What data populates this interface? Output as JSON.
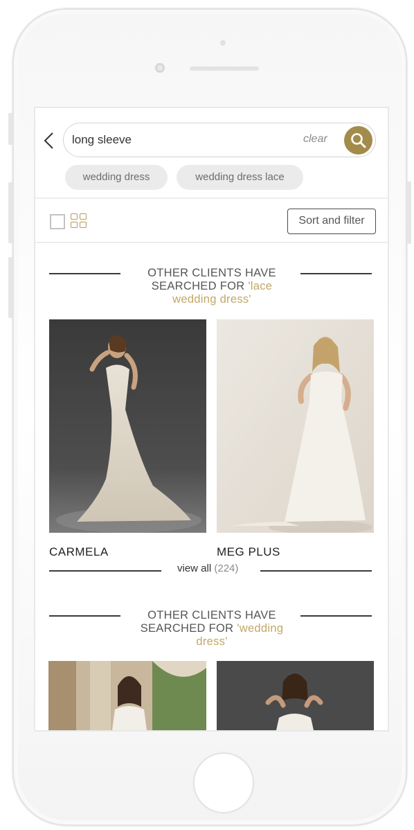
{
  "search": {
    "value": "long sleeve",
    "clear_label": "clear"
  },
  "suggestions": [
    "wedding dress",
    "wedding dress lace"
  ],
  "toolbar": {
    "sort_filter_label": "Sort and filter"
  },
  "sections": [
    {
      "heading_line1": "OTHER CLIENTS HAVE",
      "heading_prefix": "SEARCHED FOR ",
      "query_part1": "'lace",
      "query_part2": "wedding dress'",
      "products": [
        {
          "name": "CARMELA"
        },
        {
          "name": "MEG PLUS"
        }
      ],
      "view_all_label": "view all",
      "view_all_count": "(224)"
    },
    {
      "heading_line1": "OTHER CLIENTS HAVE",
      "heading_prefix": "SEARCHED FOR ",
      "query_part1": "'wedding",
      "query_part2": "dress'"
    }
  ],
  "colors": {
    "accent": "#a38c4b",
    "query_text": "#c2a864",
    "chip_bg": "#ebebeb"
  },
  "icons": [
    "back-chevron-icon",
    "search-icon",
    "single-view-icon",
    "grid-view-icon"
  ]
}
